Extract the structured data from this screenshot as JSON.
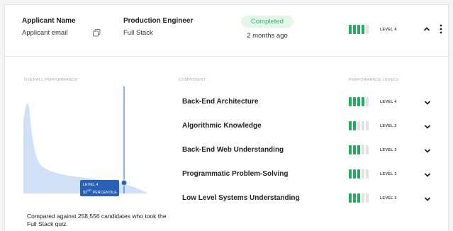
{
  "applicant": {
    "name": "Applicant Name",
    "email": "Applicant email"
  },
  "role": {
    "title": "Production Engineer",
    "track": "Full Stack"
  },
  "status": {
    "label": "Completed",
    "time": "2 months ago",
    "color": "#33b36b"
  },
  "overall_level": {
    "level": 4,
    "max": 5,
    "label": "LEVEL 4"
  },
  "columns": {
    "overall": "OVERALL PERFORMANCE",
    "component": "COMPONENT",
    "levels": "PERFORMANCE LEVELS"
  },
  "tooltip": {
    "level": "LEVEL 4",
    "percentile_num": "92",
    "percentile_sup": "ND",
    "percentile_word": "PERCENTILE"
  },
  "comparison_note": "Compared against 258,556 candidates who took the Full Stack quiz.",
  "components": [
    {
      "name": "Back-End Architecture",
      "level": 4,
      "label": "LEVEL 4"
    },
    {
      "name": "Algorithmic Knowledge",
      "level": 2,
      "label": "LEVEL 2"
    },
    {
      "name": "Back-End Web Understanding",
      "level": 3,
      "label": "LEVEL 3"
    },
    {
      "name": "Programmatic Problem-Solving",
      "level": 3,
      "label": "LEVEL 3"
    },
    {
      "name": "Low Level Systems Understanding",
      "level": 3,
      "label": "LEVEL 3"
    }
  ],
  "colors": {
    "accent_green": "#1fae5b",
    "bar_empty": "#e2e2e5",
    "distribution_fill": "#cfe0f7",
    "marker_blue": "#2860b5"
  },
  "icons": {
    "copy": "copy-icon",
    "collapse": "chevron-up-icon",
    "expand": "chevron-down-icon",
    "more": "kebab-menu-icon"
  }
}
